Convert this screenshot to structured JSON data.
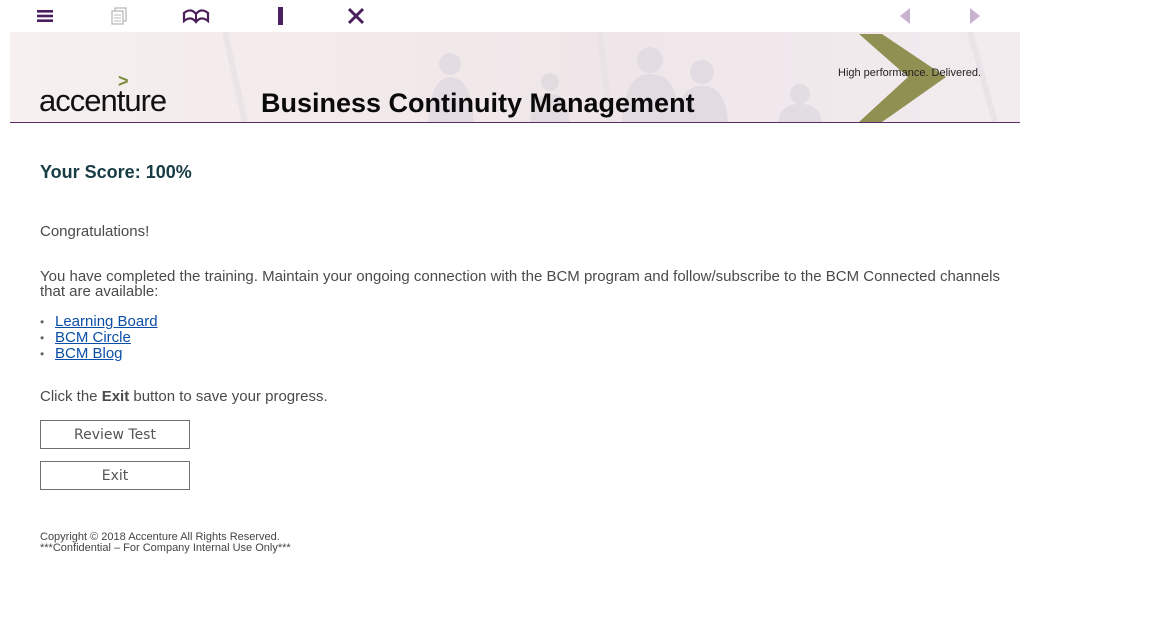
{
  "toolbar": {
    "icons": [
      "menu-icon",
      "notes-icon",
      "glossary-book-icon",
      "bookmark-icon",
      "close-icon",
      "previous-icon",
      "next-icon"
    ]
  },
  "banner": {
    "logo": "accenture",
    "title": "Business Continuity Management",
    "tagline": "High performance. Delivered."
  },
  "content": {
    "score_label": "Your Score: 100%",
    "congrats": "Congratulations!",
    "completed_text": "You have completed the training. Maintain your ongoing connection with the BCM program and follow/subscribe to the BCM Connected channels that are available:",
    "links": [
      "Learning Board",
      "BCM Circle",
      "BCM Blog"
    ],
    "exit_prefix": "Click the ",
    "exit_bold": "Exit",
    "exit_suffix": " button to save your progress."
  },
  "buttons": {
    "review": "Review Test",
    "exit": "Exit"
  },
  "footer": {
    "copyright": "Copyright © 2018 Accenture All Rights Reserved.",
    "confidential": "***Confidential – For Company Internal Use Only***"
  },
  "colors": {
    "accent_purple": "#5d2a6b",
    "brand_olive": "#8a8b4a",
    "link_blue": "#0a4ea6",
    "score_teal": "#173c44"
  }
}
